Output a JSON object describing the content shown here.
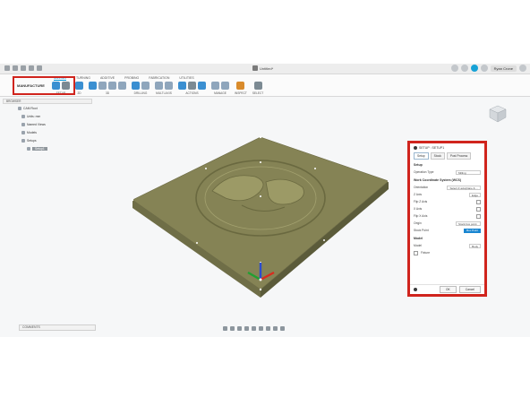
{
  "app": {
    "doc_title": "Untitled*",
    "user_name": "Ryan Crone"
  },
  "ribbon": {
    "workspace": "MANUFACTURE",
    "tabs": [
      "MILLING",
      "TURNING",
      "ADDITIVE",
      "PROBING",
      "FABRICATION",
      "UTILITIES"
    ],
    "groups": [
      "SETUP",
      "2D",
      "3D",
      "DRILLING",
      "MULTI-AXIS",
      "ACTIONS",
      "MANAGE",
      "INSPECT",
      "SELECT"
    ]
  },
  "browser": {
    "title": "BROWSER",
    "items": [
      "CAM Root",
      "Units: mm",
      "Named Views",
      "Models",
      "Setups",
      "Setup1"
    ]
  },
  "comments_label": "COMMENTS",
  "setup_panel": {
    "title": "SETUP : SETUP1",
    "tabs": [
      "Setup",
      "Stock",
      "Post Process"
    ],
    "setup_section": "Setup",
    "operation_type_label": "Operation Type",
    "operation_type_value": "Milling",
    "wcs_section": "Work Coordinate System (WCS)",
    "orientation_label": "Orientation",
    "orientation_value": "Select Z axis/plane & ...",
    "z_axis_label": "Z Axis",
    "z_axis_value": "Edge",
    "flip_z_label": "Flip Z Axis",
    "x_axis_label": "X Axis",
    "flip_x_label": "Flip X Axis",
    "origin_label": "Origin",
    "origin_value": "Stock box point",
    "stock_point_label": "Stock Point",
    "stock_point_value": "Box Point",
    "model_section": "Model",
    "model_label": "Model",
    "model_value": "Body",
    "fixture_label": "Fixture",
    "ok_label": "OK",
    "cancel_label": "Cancel"
  },
  "colors": {
    "highlight": "#d0241d",
    "accent": "#0696d7",
    "part_top": "#858355",
    "part_front": "#5b5b3a",
    "part_side": "#6f6e47"
  }
}
